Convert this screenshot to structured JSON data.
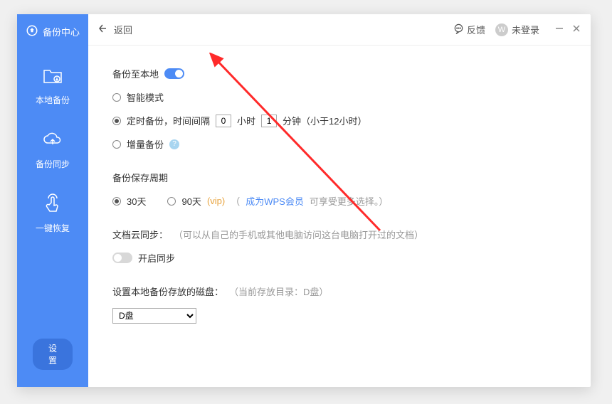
{
  "sidebar": {
    "title": "备份中心",
    "nav": [
      {
        "label": "本地备份"
      },
      {
        "label": "备份同步"
      },
      {
        "label": "一键恢复"
      }
    ],
    "settings_label": "设置"
  },
  "topbar": {
    "back_label": "返回",
    "feedback_label": "反馈",
    "avatar_letter": "W",
    "login_label": "未登录"
  },
  "content": {
    "backup_local_label": "备份至本地",
    "mode_smart": "智能模式",
    "mode_timed_prefix": "定时备份，时间间隔",
    "hours_value": "0",
    "hours_unit": "小时",
    "minutes_value": "1",
    "minutes_unit": "分钟（小于12小时）",
    "mode_incremental": "增量备份",
    "retention_title": "备份保存周期",
    "retention_30": "30天",
    "retention_90": "90天",
    "retention_vip": "(vip)",
    "retention_link": "成为WPS会员",
    "retention_suffix": " 可享受更多选择。）",
    "retention_paren_open": "（",
    "sync_title": "文档云同步：",
    "sync_note": "（可以从自己的手机或其他电脑访问这台电脑打开过的文档）",
    "sync_toggle_label": "开启同步",
    "disk_title": "设置本地备份存放的磁盘：",
    "disk_note": "（当前存放目录：D盘）",
    "disk_selected": "D盘"
  }
}
